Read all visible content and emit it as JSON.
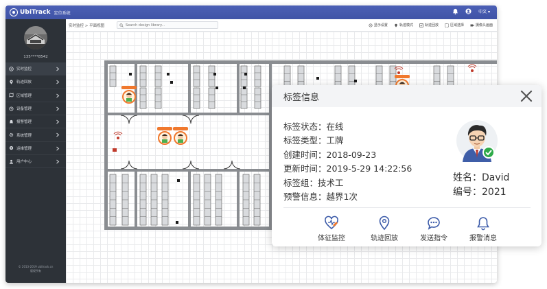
{
  "app": {
    "brand_name": "UbiTrack",
    "brand_sub": "定位系统",
    "language": "中文",
    "colors": {
      "header": "#4456ab",
      "sidebar": "#2d3238",
      "accent": "#3c5ba9",
      "tag_orange": "#f0782d",
      "online_green": "#2eaa49",
      "alarm_red": "#d23c2a"
    }
  },
  "sidebar": {
    "user_id": "135****8542",
    "items": [
      {
        "label": "实时监控",
        "icon": "monitor-icon"
      },
      {
        "label": "轨迹回放",
        "icon": "location-pin-icon"
      },
      {
        "label": "区域管理",
        "icon": "map-icon"
      },
      {
        "label": "设备管理",
        "icon": "device-icon"
      },
      {
        "label": "报警管理",
        "icon": "bell-icon"
      },
      {
        "label": "系统管理",
        "icon": "gear-icon"
      },
      {
        "label": "运维管理",
        "icon": "wrench-icon"
      },
      {
        "label": "用户中心",
        "icon": "user-icon"
      }
    ],
    "copyright_line1": "© 2013-2019 ubitrack.cn",
    "copyright_line2": "版权所有"
  },
  "toolbar": {
    "breadcrumb": "实时监控 > 平面视图",
    "search_placeholder": "Search design library...",
    "tools": [
      {
        "label": "显示设置",
        "icon": "display-settings-icon"
      },
      {
        "label": "轨迹模式",
        "icon": "track-mode-icon"
      },
      {
        "label": "轨迹回放",
        "icon": "track-playback-icon"
      },
      {
        "label": "区域选择",
        "icon": "area-select-icon"
      },
      {
        "label": "摄像头画面",
        "icon": "camera-icon"
      }
    ]
  },
  "tag_panel": {
    "title": "标签信息",
    "rows": [
      "标签状态：在线",
      "标签类型：工牌",
      "创建时间：2018-09-23",
      "更新时间：2019-5-29  14:22:56",
      "标签组：技术工",
      "预警信息：越界1次"
    ],
    "name": "姓名：David",
    "number": "编号：2021",
    "actions": [
      {
        "label": "体征监控",
        "icon": "heart-rate-icon"
      },
      {
        "label": "轨迹回放",
        "icon": "location-pin-icon"
      },
      {
        "label": "发送指令",
        "icon": "chat-bubble-icon"
      },
      {
        "label": "报警消息",
        "icon": "bell-icon"
      }
    ]
  }
}
